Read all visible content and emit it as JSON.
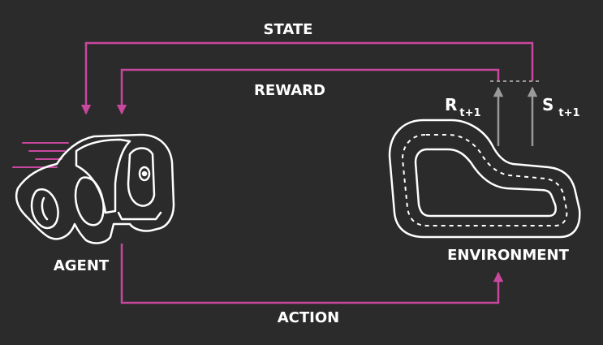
{
  "labels": {
    "state": "STATE",
    "reward": "REWARD",
    "action": "ACTION",
    "agent": "AGENT",
    "environment": "ENVIRONMENT",
    "reward_signal": "R",
    "reward_signal_sub": "t+1",
    "state_signal": "S",
    "state_signal_sub": "t+1"
  },
  "colors": {
    "background": "#2b2b2b",
    "loop_lines": "#c9479f",
    "signal_arrows": "#9a9a9a",
    "outline": "#ffffff"
  },
  "icons": {
    "agent": "race-car-icon",
    "environment": "race-track-icon"
  }
}
